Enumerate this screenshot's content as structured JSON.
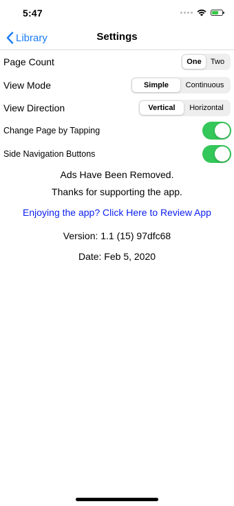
{
  "status_bar": {
    "time": "5:47",
    "signal_icon": "signal-dots-icon",
    "wifi_icon": "wifi-icon",
    "battery_icon": "battery-charging-icon",
    "battery_color": "#38c847"
  },
  "nav": {
    "back_label": "Library",
    "back_icon": "chevron-left-icon",
    "title": "Settings",
    "accent": "#1a7cf5"
  },
  "settings": {
    "page_count": {
      "label": "Page Count",
      "options": [
        "One",
        "Two"
      ],
      "selected": "One"
    },
    "view_mode": {
      "label": "View Mode",
      "options": [
        "Simple",
        "Continuous"
      ],
      "selected": "Simple"
    },
    "view_direction": {
      "label": "View Direction",
      "options": [
        "Vertical",
        "Horizontal"
      ],
      "selected": "Vertical"
    },
    "change_page_by_tapping": {
      "label": "Change Page by Tapping",
      "on": true
    },
    "side_navigation_buttons": {
      "label": "Side Navigation Buttons",
      "on": true
    },
    "toggle_color": "#34c759"
  },
  "info": {
    "ads_removed": "Ads Have Been Removed.",
    "thanks": "Thanks for supporting the app.",
    "review_link": "Enjoying the app? Click Here to Review App",
    "review_link_color": "#0b1ef0",
    "version": "Version: 1.1 (15) 97dfc68",
    "date": "Date: Feb 5, 2020"
  }
}
